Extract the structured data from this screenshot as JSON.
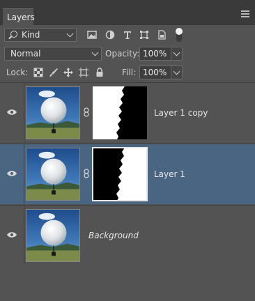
{
  "panel": {
    "tab_label": "Layers"
  },
  "filter": {
    "kind_label": "Kind",
    "icons": [
      "image-filter-icon",
      "adjustment-filter-icon",
      "type-filter-icon",
      "shape-filter-icon",
      "smart-object-filter-icon",
      "filter-toggle"
    ]
  },
  "blend": {
    "mode": "Normal",
    "opacity_label": "Opacity:",
    "opacity_value": "100%",
    "lock_label": "Lock:",
    "fill_label": "Fill:",
    "fill_value": "100%"
  },
  "layers": [
    {
      "name": "Layer 1 copy",
      "visible": true,
      "selected": false,
      "has_mask": true
    },
    {
      "name": "Layer 1",
      "visible": true,
      "selected": true,
      "has_mask": true
    },
    {
      "name": "Background",
      "visible": true,
      "selected": false,
      "has_mask": false
    }
  ],
  "colors": {
    "panel_bg": "#535353",
    "selected_row": "#4a6581",
    "tab_bar": "#3a3a3a"
  }
}
